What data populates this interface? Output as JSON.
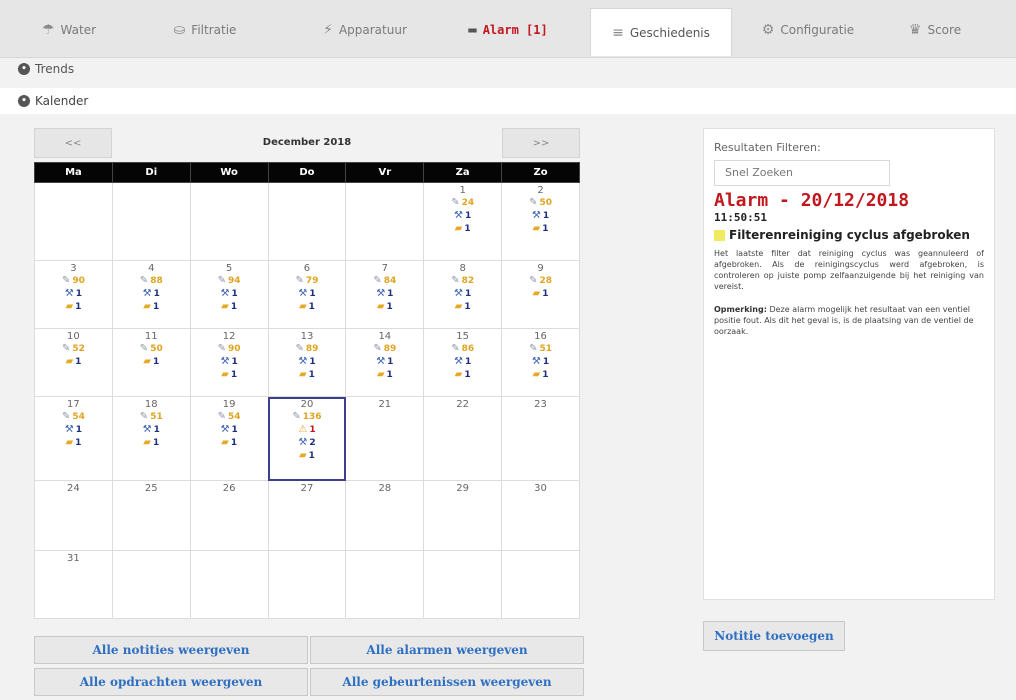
{
  "tabs": [
    {
      "label": "Water",
      "icon": "water-icon"
    },
    {
      "label": "Filtratie",
      "icon": "filter-icon"
    },
    {
      "label": "Apparatuur",
      "icon": "plug-icon"
    },
    {
      "label": "Alarm [1]",
      "icon": "alarm-icon"
    },
    {
      "label": "Geschiedenis",
      "icon": "history-icon"
    },
    {
      "label": "Configuratie",
      "icon": "config-icon"
    },
    {
      "label": "Score",
      "icon": "trophy-icon"
    }
  ],
  "subnav": {
    "trends": "Trends",
    "kalender": "Kalender"
  },
  "calendar": {
    "prev": "<<",
    "next": ">>",
    "month": "December 2018",
    "weekdays": [
      "Ma",
      "Di",
      "Wo",
      "Do",
      "Vr",
      "Za",
      "Zo"
    ],
    "weeks": [
      [
        null,
        null,
        null,
        null,
        null,
        {
          "day": "1",
          "events": [
            {
              "kind": "note",
              "n": "24"
            },
            {
              "kind": "task",
              "n": "1"
            },
            {
              "kind": "fold",
              "n": "1"
            }
          ]
        },
        {
          "day": "2",
          "events": [
            {
              "kind": "note",
              "n": "50"
            },
            {
              "kind": "task",
              "n": "1"
            },
            {
              "kind": "fold",
              "n": "1"
            }
          ]
        }
      ],
      [
        {
          "day": "3",
          "events": [
            {
              "kind": "note",
              "n": "90"
            },
            {
              "kind": "task",
              "n": "1"
            },
            {
              "kind": "fold",
              "n": "1"
            }
          ]
        },
        {
          "day": "4",
          "events": [
            {
              "kind": "note",
              "n": "88"
            },
            {
              "kind": "task",
              "n": "1"
            },
            {
              "kind": "fold",
              "n": "1"
            }
          ]
        },
        {
          "day": "5",
          "events": [
            {
              "kind": "note",
              "n": "94"
            },
            {
              "kind": "task",
              "n": "1"
            },
            {
              "kind": "fold",
              "n": "1"
            }
          ]
        },
        {
          "day": "6",
          "events": [
            {
              "kind": "note",
              "n": "79"
            },
            {
              "kind": "task",
              "n": "1"
            },
            {
              "kind": "fold",
              "n": "1"
            }
          ]
        },
        {
          "day": "7",
          "events": [
            {
              "kind": "note",
              "n": "84"
            },
            {
              "kind": "task",
              "n": "1"
            },
            {
              "kind": "fold",
              "n": "1"
            }
          ]
        },
        {
          "day": "8",
          "events": [
            {
              "kind": "note",
              "n": "82"
            },
            {
              "kind": "task",
              "n": "1"
            },
            {
              "kind": "fold",
              "n": "1"
            }
          ]
        },
        {
          "day": "9",
          "events": [
            {
              "kind": "note",
              "n": "28"
            },
            {
              "kind": "fold",
              "n": "1"
            }
          ]
        }
      ],
      [
        {
          "day": "10",
          "events": [
            {
              "kind": "note",
              "n": "52"
            },
            {
              "kind": "fold",
              "n": "1"
            }
          ]
        },
        {
          "day": "11",
          "events": [
            {
              "kind": "note",
              "n": "50"
            },
            {
              "kind": "fold",
              "n": "1"
            }
          ]
        },
        {
          "day": "12",
          "events": [
            {
              "kind": "note",
              "n": "90"
            },
            {
              "kind": "task",
              "n": "1"
            },
            {
              "kind": "fold",
              "n": "1"
            }
          ]
        },
        {
          "day": "13",
          "events": [
            {
              "kind": "note",
              "n": "89"
            },
            {
              "kind": "task",
              "n": "1"
            },
            {
              "kind": "fold",
              "n": "1"
            }
          ]
        },
        {
          "day": "14",
          "events": [
            {
              "kind": "note",
              "n": "89"
            },
            {
              "kind": "task",
              "n": "1"
            },
            {
              "kind": "fold",
              "n": "1"
            }
          ]
        },
        {
          "day": "15",
          "events": [
            {
              "kind": "note",
              "n": "86"
            },
            {
              "kind": "task",
              "n": "1"
            },
            {
              "kind": "fold",
              "n": "1"
            }
          ]
        },
        {
          "day": "16",
          "events": [
            {
              "kind": "note",
              "n": "51"
            },
            {
              "kind": "task",
              "n": "1"
            },
            {
              "kind": "fold",
              "n": "1"
            }
          ]
        }
      ],
      [
        {
          "day": "17",
          "events": [
            {
              "kind": "note",
              "n": "54"
            },
            {
              "kind": "task",
              "n": "1"
            },
            {
              "kind": "fold",
              "n": "1"
            }
          ]
        },
        {
          "day": "18",
          "events": [
            {
              "kind": "note",
              "n": "51"
            },
            {
              "kind": "task",
              "n": "1"
            },
            {
              "kind": "fold",
              "n": "1"
            }
          ]
        },
        {
          "day": "19",
          "events": [
            {
              "kind": "note",
              "n": "54"
            },
            {
              "kind": "task",
              "n": "1"
            },
            {
              "kind": "fold",
              "n": "1"
            }
          ]
        },
        {
          "day": "20",
          "selected": true,
          "events": [
            {
              "kind": "note",
              "n": "136"
            },
            {
              "kind": "warn",
              "n": "1"
            },
            {
              "kind": "task",
              "n": "2"
            },
            {
              "kind": "fold",
              "n": "1"
            }
          ]
        },
        {
          "day": "21",
          "events": []
        },
        {
          "day": "22",
          "events": []
        },
        {
          "day": "23",
          "events": []
        }
      ],
      [
        {
          "day": "24",
          "events": []
        },
        {
          "day": "25",
          "events": []
        },
        {
          "day": "26",
          "events": []
        },
        {
          "day": "27",
          "events": []
        },
        {
          "day": "28",
          "events": []
        },
        {
          "day": "29",
          "events": []
        },
        {
          "day": "30",
          "events": []
        }
      ],
      [
        {
          "day": "31",
          "events": []
        },
        null,
        null,
        null,
        null,
        null,
        null
      ]
    ]
  },
  "buttons": {
    "notes": "Alle notities weergeven",
    "alarms": "Alle alarmen weergeven",
    "tasks": "Alle opdrachten weergeven",
    "events": "Alle gebeurtenissen weergeven",
    "add_note": "Notitie toevoegen"
  },
  "panel": {
    "filter_title": "Resultaten Filteren:",
    "search_placeholder": "Snel Zoeken",
    "alarm_title": "Alarm - 20/12/2018",
    "alarm_time": "11:50:51",
    "alarm_name": "Filterenreiniging cyclus afgebroken",
    "alarm_desc": "Het laatste filter dat reiniging cyclus was geannuleerd of afgebroken. Als de reinigingscyclus werd afgebroken, is controleren op juiste pomp zelfaanzuigende bij het reiniging van vereist.",
    "remark_label": "Opmerking:",
    "remark_text": " Deze alarm mogelijk het resultaat van een ventiel positie fout. Als dit het geval is, is de plaatsing van de ventiel de oorzaak."
  },
  "colors": {
    "alarm_red": "#c0181e",
    "link_blue": "#2f6fc1",
    "header_black": "#050505"
  }
}
